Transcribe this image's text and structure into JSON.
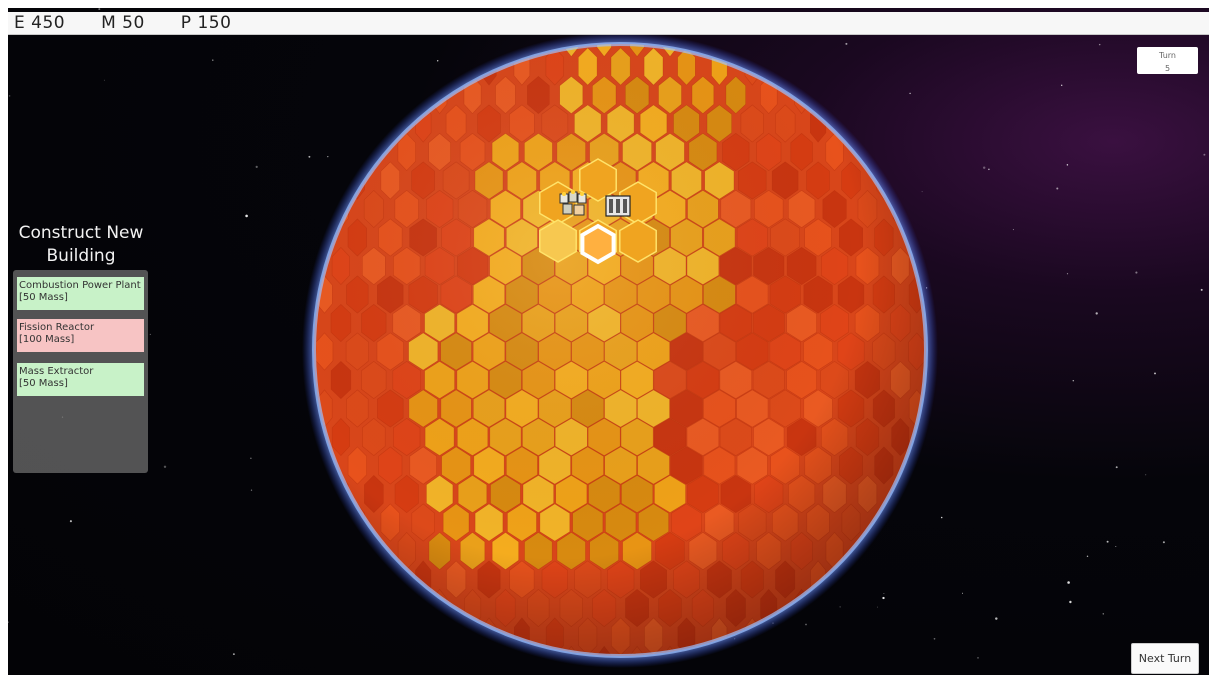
{
  "resources": {
    "energy": "E 450",
    "mass": "M 50",
    "power": "P 150"
  },
  "turn": {
    "label": "Turn",
    "value": "5"
  },
  "build_panel": {
    "title_line1": "Construct New",
    "title_line2": "Building",
    "options": [
      {
        "name": "Combustion Power Plant",
        "cost": "[50 Mass]",
        "affordable": true
      },
      {
        "name": "Fission Reactor",
        "cost": "[100 Mass]",
        "affordable": false
      },
      {
        "name": "Mass Extractor",
        "cost": "[50 Mass]",
        "affordable": true
      }
    ]
  },
  "next_turn_label": "Next Turn",
  "colors": {
    "affordable": "#c8f2c8",
    "unaffordable": "#f7c4c4",
    "tile_red": "#e04418",
    "tile_orange": "#f0a218",
    "highlight": "#ffe36a",
    "atmosphere": "#7aa8ff"
  },
  "icons": [
    "building-cluster-icon",
    "factory-icon"
  ]
}
